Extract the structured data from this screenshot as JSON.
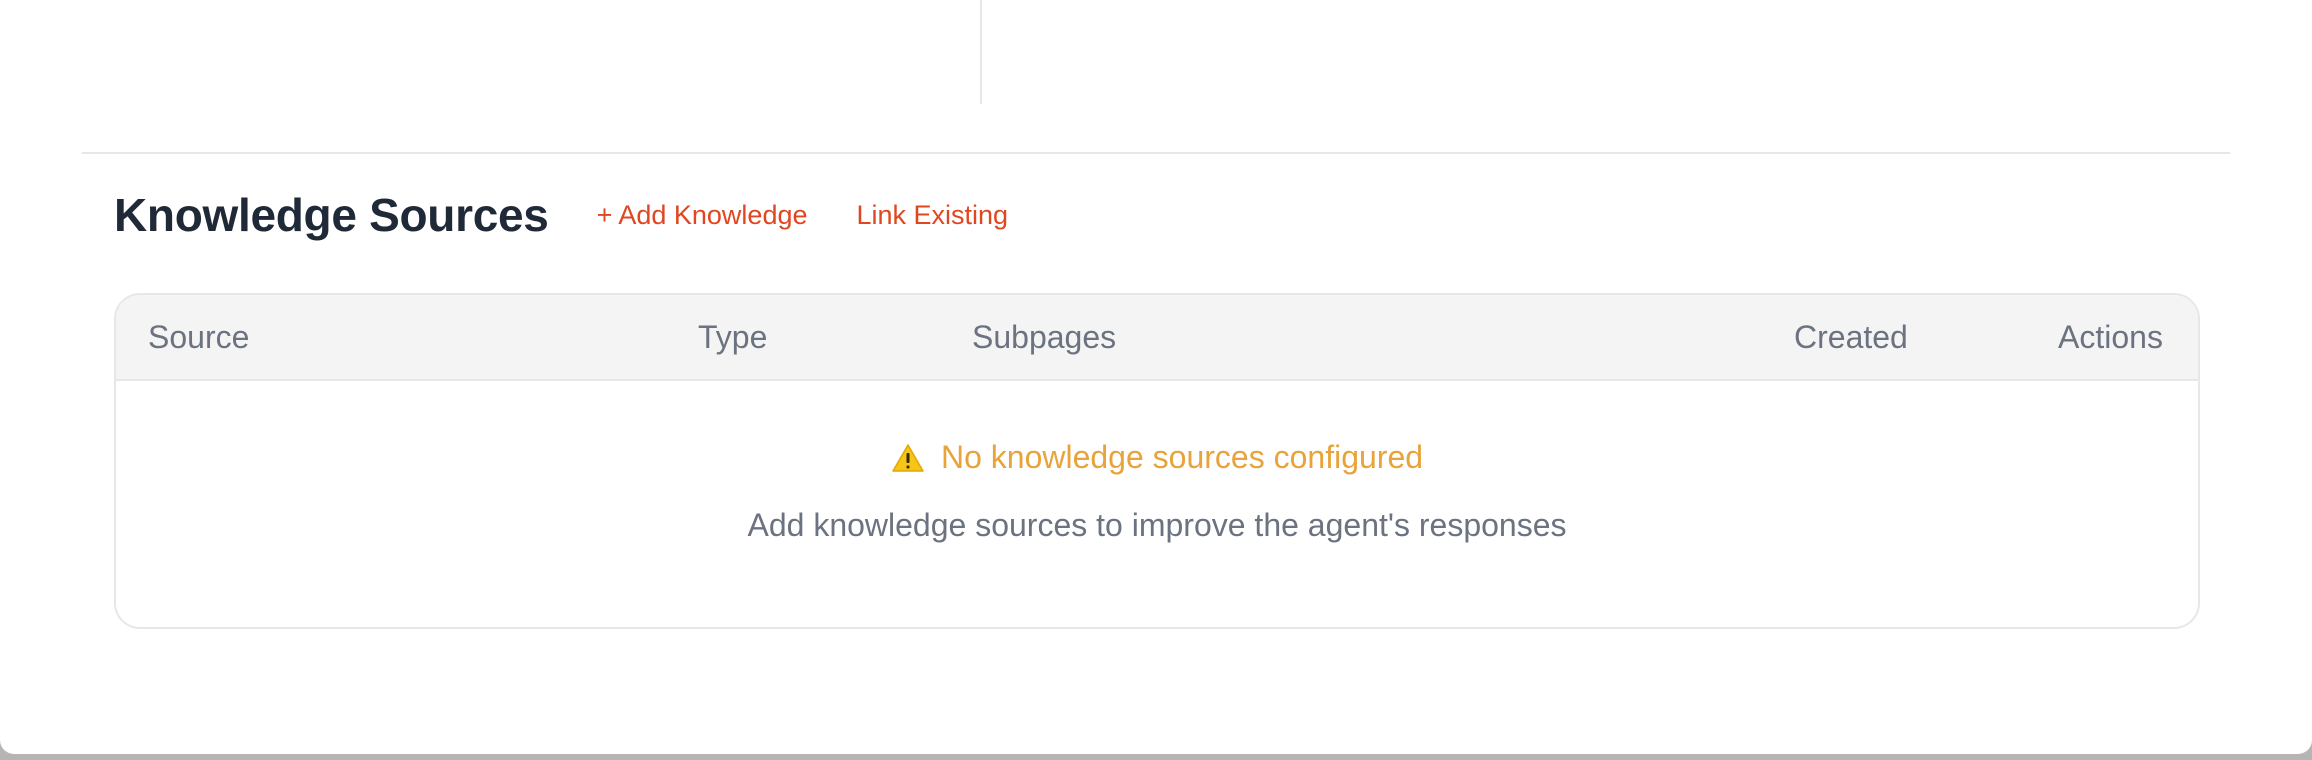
{
  "knowledge": {
    "title": "Knowledge Sources",
    "add_label": "+ Add Knowledge",
    "link_label": "Link Existing",
    "columns": [
      "Source",
      "Type",
      "Subpages",
      "Created",
      "Actions"
    ],
    "empty": {
      "icon": "warning-icon",
      "message": "No knowledge sources configured",
      "hint": "Add knowledge sources to improve the agent's responses"
    }
  },
  "colors": {
    "accent": "#e0461f",
    "warning": "#e8a33a",
    "title": "#1f2937",
    "muted": "#6b7280"
  }
}
